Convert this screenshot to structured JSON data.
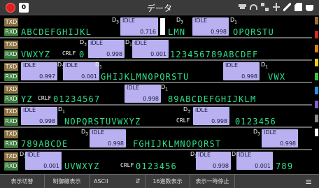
{
  "title": "データ",
  "page_badge": "0",
  "status_icons": [
    "printer-icon",
    "wifi-icon",
    "network-icon",
    "usb-icon",
    "pen-icon",
    "sd-card-icon",
    "power-icon"
  ],
  "direction_labels": {
    "txd": "TXD",
    "rxd": "RXD"
  },
  "idle_label": "IDLE",
  "rows": [
    {
      "txd_text": [
        "ABCDEFGHIJKL",
        "LMN",
        "OPQRSTU"
      ],
      "dtags": [
        "D3",
        "D3",
        "D1"
      ],
      "idle_values": [
        "0.716",
        "0.998"
      ]
    },
    {
      "txd_text": [
        "VWXYZ",
        "CRLF",
        "0",
        "123456789ABCDEF"
      ],
      "dtags": [
        "D3",
        "D1"
      ],
      "idle_values": [
        "0.998",
        "0.001"
      ]
    },
    {
      "rxd_text": [
        "GHIJKLMNOPQRSTU",
        "VWX"
      ],
      "dtags": [
        "D3",
        "D1",
        "D1"
      ],
      "idle_values": [
        "0.997",
        "0.001",
        "0.998"
      ]
    },
    {
      "rxd_text": [
        "YZ",
        "CRLF",
        "01234567",
        "89ABCDEFGHIJKLM"
      ],
      "dtags": [
        "D1"
      ],
      "idle_values": [
        "0.998"
      ]
    },
    {
      "txd_text": [
        "NOPQRSTUVWXYZ",
        "CRLF",
        "0123456"
      ],
      "dtags": [
        "D1",
        "D3"
      ],
      "idle_values": [
        "0.998",
        "0.998"
      ]
    },
    {
      "rxd_text": [
        "789ABCDE",
        "FGHIJKLMNOPQRST"
      ],
      "dtags": [
        "D3",
        "D3"
      ],
      "idle_values": [
        "0.998",
        "0.998"
      ]
    },
    {
      "rxd_text": [
        "UVWXYZ",
        "CRLF",
        "0123456",
        "789"
      ],
      "dtags": [
        "D1",
        "D1",
        "D1"
      ],
      "idle_values": [
        "0.001",
        "0.998",
        "0.001"
      ]
    }
  ],
  "rail_colors": [
    "#9b6b3b",
    "#d02a2a",
    "#e07a20",
    "#e0d020",
    "#40c040",
    "#2a90e0",
    "#8a5ad0",
    "#888888",
    "#ffffff"
  ],
  "toolbar": {
    "display_switch": "表示切替",
    "control_line": "制御線表示",
    "encoding_value": "ASCII",
    "hex_display": "16進数表示",
    "pause_display": "表示一時停止",
    "menu_icon": "menu-icon"
  }
}
